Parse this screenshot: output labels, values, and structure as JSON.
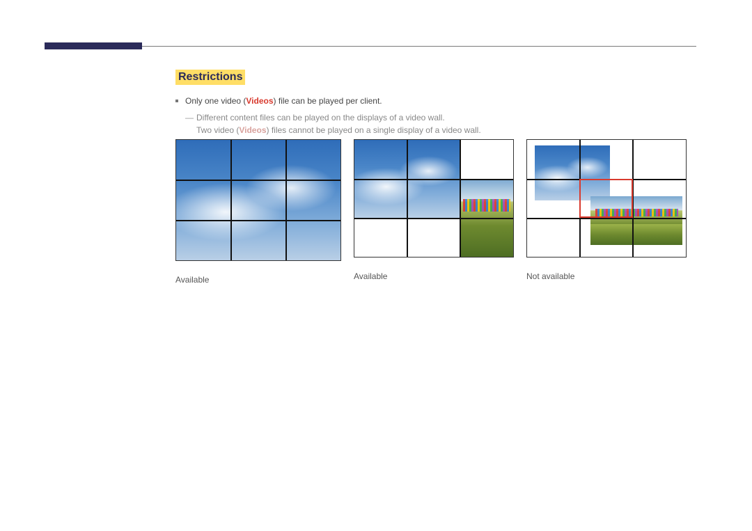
{
  "heading": "Restrictions",
  "bullet1_pre": "Only one video (",
  "bullet1_videos": "Videos",
  "bullet1_post": ") file can be played per client.",
  "sub_dash": "―",
  "sub_line1": "Different content files can be played on the displays of a video wall.",
  "sub_line2_pre": "Two video (",
  "sub_line2_videos": "Videos",
  "sub_line2_post": ") files cannot be played on a single display of a video wall.",
  "captions": {
    "fig1": "Available",
    "fig2": "Available",
    "fig3": "Not available"
  }
}
